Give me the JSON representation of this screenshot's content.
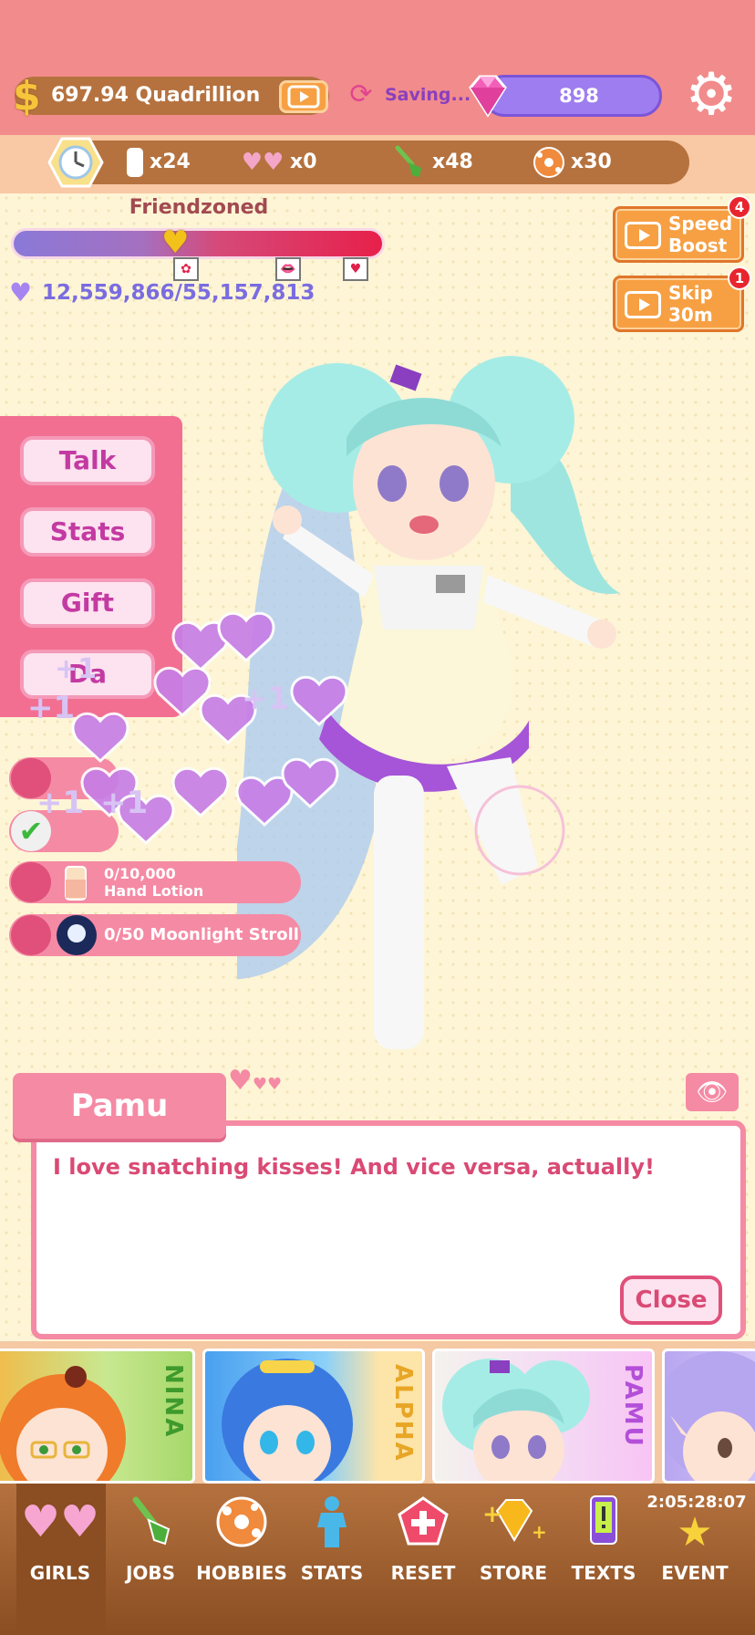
{
  "currency": {
    "money": "697.94 Quadrillion",
    "saving": "Saving...",
    "gems": "898"
  },
  "resources": [
    {
      "icon": "clock-icon",
      "value": ""
    },
    {
      "icon": "card-icon",
      "value": "x24"
    },
    {
      "icon": "hearts-icon",
      "value": "x0"
    },
    {
      "icon": "shovel-icon",
      "value": "x48"
    },
    {
      "icon": "ball-icon",
      "value": "x30"
    }
  ],
  "relationship": {
    "level": "Friendzoned",
    "progress": "12,559,866/55,157,813",
    "progress_fraction": 0.23
  },
  "boosts": {
    "speed": {
      "label": "Speed Boost",
      "badge": "4"
    },
    "skip": {
      "label": "Skip 30m",
      "badge": "1"
    }
  },
  "actions": [
    "Talk",
    "Stats",
    "Gift",
    "Da"
  ],
  "goals": [
    {
      "text1": "0/10,000",
      "text2": "Hand Lotion"
    },
    {
      "text1": "0/50 Moonlight Stroll",
      "text2": ""
    }
  ],
  "float_text": "+1",
  "dialog": {
    "speaker": "Pamu",
    "text": "I love snatching kisses! And vice versa, actually!",
    "close_label": "Close"
  },
  "girls": [
    "NINA",
    "ALPHA",
    "PAMU"
  ],
  "nav": {
    "items": [
      "GIRLS",
      "JOBS",
      "HOBBIES",
      "STATS",
      "RESET",
      "STORE",
      "TEXTS",
      "EVENT"
    ],
    "timer": "2:05:28:07"
  },
  "colors": {
    "topbar": "#f28b8b",
    "accent_pink": "#f58aa4",
    "gem_purple": "#9e7df0",
    "brown": "#b5723f"
  }
}
